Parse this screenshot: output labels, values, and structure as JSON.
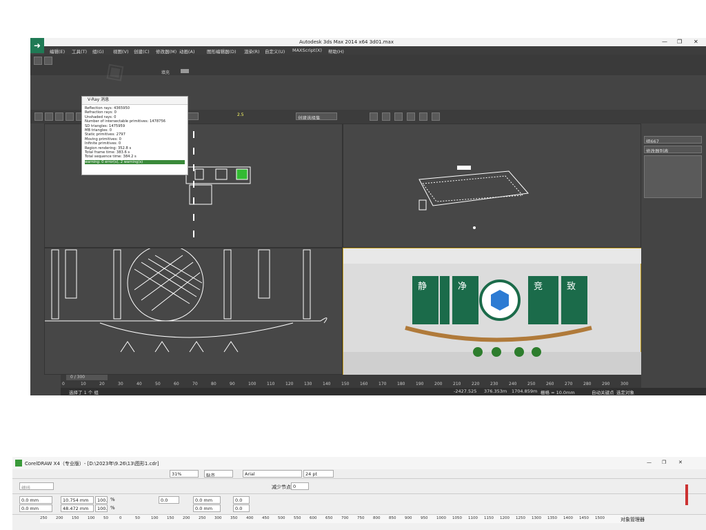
{
  "max": {
    "title": "Autodesk 3ds Max  2014 x64     3d01.max",
    "menu": [
      "编辑(E)",
      "工具(T)",
      "组(G)",
      "视图(V)",
      "创建(C)",
      "修改器(M)",
      "动画(A)",
      "图形编辑器(D)",
      "渲染(R)",
      "自定义(U)",
      "MAXScript(X)",
      "帮助(H)"
    ],
    "selection_filter": "视图",
    "selection_set": "创建选择集",
    "vray": {
      "title": "V-Ray 消息",
      "lines": [
        "Reflection rays: 4365950",
        "Refraction rays: 0",
        "Unshaded rays: 0",
        "Number of intersectable primitives: 1478756",
        "SD triangles: 1475959",
        "MB triangles: 0",
        "Static primitives: 2797",
        "Moving primitives: 0",
        "Infinite primitives: 0",
        "Region rendering: 352.8 s",
        "Total frame time: 383.6 s",
        "Total sequence time: 384.2 s"
      ],
      "warning": "warning: 0 error(s), 2 warning(s)"
    },
    "snap_value": "2.5",
    "viewport_tab": "填充",
    "object_name": "组667",
    "modifier_list": "修改器列表",
    "timeline": "0 / 300",
    "ruler": [
      "0",
      "10",
      "20",
      "30",
      "40",
      "50",
      "60",
      "70",
      "80",
      "90",
      "100",
      "110",
      "120",
      "130",
      "140",
      "150",
      "160",
      "170",
      "180",
      "190",
      "200",
      "210",
      "220",
      "230",
      "240",
      "250",
      "260",
      "270",
      "280",
      "290",
      "300"
    ],
    "status": "选择了 1 个 组",
    "x": "-2427.525",
    "y": "376.353m",
    "z": "1704.859m",
    "grid": "栅格 = 10.0mm",
    "autokey": "自动关键点",
    "selected": "选定对象",
    "render_chars": [
      "静",
      "净",
      "竞",
      "致"
    ]
  },
  "cdr": {
    "title": "CorelDRAW X4（专业版）- [D:\\2023年\\9.26\\13\\图形1.cdr]",
    "zoom": "31%",
    "snap": "贴齐",
    "font": "Arial",
    "size": "24 pt",
    "x": "0.0 mm",
    "y": "0.0 mm",
    "w": "10.754 mm",
    "h": "48.472 mm",
    "sx": "100.0",
    "sy": "100.0",
    "pct": "%",
    "rot": "0.0",
    "px": "0.0 mm",
    "py": "0.0 mm",
    "o1": "0.0",
    "o2": "0.0",
    "reduce": "减少节点",
    "reduce_val": "0",
    "outline": "细线",
    "docker": "对象管理器",
    "ruler": [
      "250",
      "200",
      "150",
      "100",
      "50",
      "0",
      "50",
      "100",
      "150",
      "200",
      "250",
      "300",
      "350",
      "400",
      "450",
      "500",
      "550",
      "600",
      "650",
      "700",
      "750",
      "800",
      "850",
      "900",
      "950",
      "1000",
      "1050",
      "1100",
      "1150",
      "1200",
      "1250",
      "1300",
      "1350",
      "1400",
      "1450",
      "1500"
    ]
  }
}
